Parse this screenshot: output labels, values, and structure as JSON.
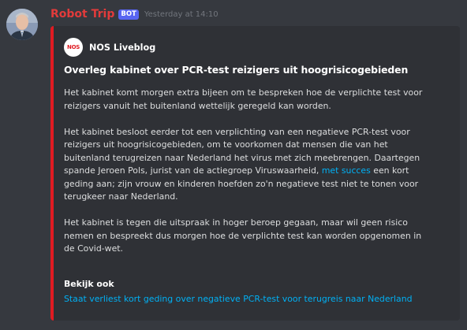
{
  "message": {
    "username": "Robot Trip",
    "bot_tag": "BOT",
    "timestamp": "Yesterday at 14:10"
  },
  "embed": {
    "accent_color": "#e01b22",
    "author": {
      "logo_text": "NOS",
      "logo_subtext": "",
      "name": "NOS Liveblog"
    },
    "title": "Overleg kabinet over PCR-test reizigers uit hoogrisicogebieden",
    "paragraph1": {
      "line1": "Het kabinet komt morgen extra bijeen om te bespreken hoe de verplichte test voor",
      "line2": "reizigers vanuit het buitenland wettelijk geregeld kan worden."
    },
    "paragraph2": {
      "line1": "Het kabinet besloot eerder tot een verplichting van een negatieve PCR-test voor",
      "line2": "reizigers uit hoogrisicogebieden, om te voorkomen dat mensen die van het",
      "line3": "buitenland terugreizen naar Nederland het virus met zich meebrengen. Daartegen",
      "line4_before": "spande Jeroen Pols, jurist van de actiegroep Viruswaarheid, ",
      "line4_link": "met succes",
      "line4_after": " een kort",
      "line5": "geding aan; zijn vrouw en kinderen hoefden zo'n negatieve test niet te tonen voor",
      "line6": "terugkeer naar Nederland."
    },
    "paragraph3": {
      "line1": "Het kabinet is tegen die uitspraak in hoger beroep gegaan, maar wil geen risico",
      "line2": "nemen en bespreekt dus morgen hoe de verplichte test kan worden opgenomen in",
      "line3": "de Covid-wet."
    },
    "field": {
      "name": "Bekijk ook",
      "value": "Staat verliest kort geding over negatieve PCR-test voor terugreis naar Nederland"
    }
  },
  "colors": {
    "background": "#36393f",
    "embed_background": "#2f3136",
    "username": "#e23b3b",
    "link": "#00b0f4",
    "bot_tag": "#5865f2"
  }
}
